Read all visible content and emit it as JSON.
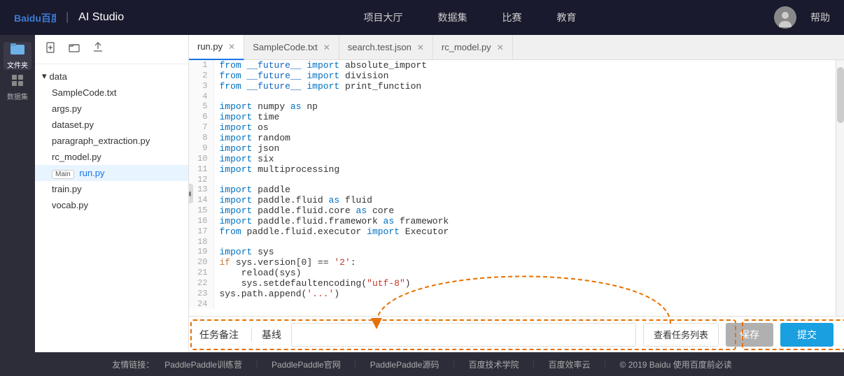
{
  "app": {
    "title": "AI Studio",
    "logo": "Baidu百度",
    "separator": "|"
  },
  "nav": {
    "items": [
      {
        "label": "项目大厅"
      },
      {
        "label": "数据集"
      },
      {
        "label": "比赛"
      },
      {
        "label": "教育"
      }
    ],
    "help": "帮助"
  },
  "tabs": [
    {
      "label": "run.py",
      "active": true
    },
    {
      "label": "SampleCode.txt",
      "active": false
    },
    {
      "label": "search.test.json",
      "active": false
    },
    {
      "label": "rc_model.py",
      "active": false
    }
  ],
  "sidebar": {
    "icons": [
      {
        "label": "文件夹",
        "symbol": "📁",
        "active": true
      },
      {
        "label": "数据集",
        "symbol": "⠿",
        "active": false
      }
    ]
  },
  "file_tree": {
    "toolbar_buttons": [
      "＋",
      "📁",
      "↑"
    ],
    "folder": "data",
    "files": [
      {
        "name": "SampleCode.txt",
        "badge": null,
        "main": false,
        "active": false,
        "highlight": false
      },
      {
        "name": "args.py",
        "badge": null,
        "main": false,
        "active": false,
        "highlight": false
      },
      {
        "name": "dataset.py",
        "badge": null,
        "main": false,
        "active": false,
        "highlight": false
      },
      {
        "name": "paragraph_extraction.py",
        "badge": null,
        "main": false,
        "active": false,
        "highlight": false
      },
      {
        "name": "rc_model.py",
        "badge": null,
        "main": false,
        "active": false,
        "highlight": false
      },
      {
        "name": "run.py",
        "badge": "Main",
        "main": true,
        "active": true,
        "highlight": true
      },
      {
        "name": "train.py",
        "badge": null,
        "main": false,
        "active": false,
        "highlight": false
      },
      {
        "name": "vocab.py",
        "badge": null,
        "main": false,
        "active": false,
        "highlight": false
      }
    ]
  },
  "code_lines": [
    {
      "num": 1,
      "code": "from __future__ import absolute_import"
    },
    {
      "num": 2,
      "code": "from __future__ import division"
    },
    {
      "num": 3,
      "code": "from __future__ import print_function"
    },
    {
      "num": 4,
      "code": ""
    },
    {
      "num": 5,
      "code": "import numpy as np"
    },
    {
      "num": 6,
      "code": "import time"
    },
    {
      "num": 7,
      "code": "import os"
    },
    {
      "num": 8,
      "code": "import random"
    },
    {
      "num": 9,
      "code": "import json"
    },
    {
      "num": 10,
      "code": "import six"
    },
    {
      "num": 11,
      "code": "import multiprocessing"
    },
    {
      "num": 12,
      "code": ""
    },
    {
      "num": 13,
      "code": "import paddle"
    },
    {
      "num": 14,
      "code": "import paddle.fluid as fluid"
    },
    {
      "num": 15,
      "code": "import paddle.fluid.core as core"
    },
    {
      "num": 16,
      "code": "import paddle.fluid.framework as framework"
    },
    {
      "num": 17,
      "code": "from paddle.fluid.executor import Executor"
    },
    {
      "num": 18,
      "code": ""
    },
    {
      "num": 19,
      "code": "import sys"
    },
    {
      "num": 20,
      "code": "if sys.version[0] == '2':"
    },
    {
      "num": 21,
      "code": "    reload(sys)"
    },
    {
      "num": 22,
      "code": "    sys.setdefaultencoding(\"utf-8\")"
    },
    {
      "num": 23,
      "code": "sys.path.append('...')"
    },
    {
      "num": 24,
      "code": ""
    }
  ],
  "bottom": {
    "task_label": "任务备注",
    "baseline_label": "基线",
    "input_placeholder": "",
    "view_tasks": "查看任务列表",
    "save": "保存",
    "submit": "提交"
  },
  "footer": {
    "prefix": "友情链接：",
    "links": [
      "PaddlePaddle训练营",
      "PaddlePaddle官网",
      "PaddlePaddle源码",
      "百度技术学院",
      "百度效率云"
    ],
    "copyright": "© 2019 Baidu 使用百度前必读"
  }
}
